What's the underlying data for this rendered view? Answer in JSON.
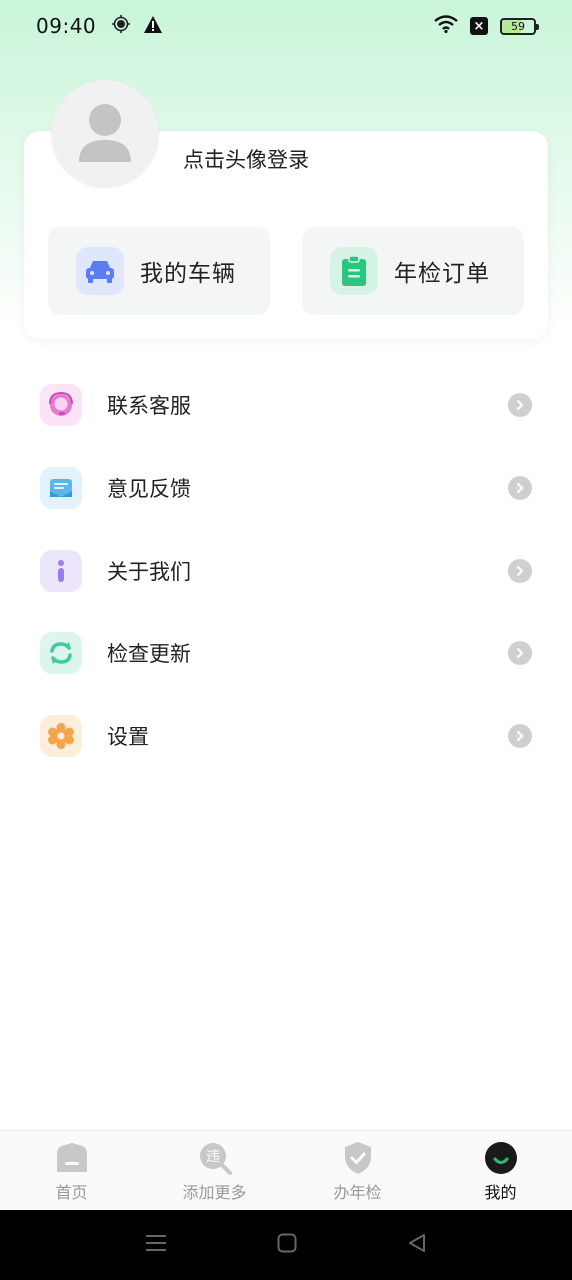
{
  "status_bar": {
    "time": "09:40",
    "battery": "59"
  },
  "profile": {
    "login_prompt": "点击头像登录",
    "quick_actions": [
      {
        "label": "我的车辆",
        "icon": "car-icon",
        "color": "#5b7cf2"
      },
      {
        "label": "年检订单",
        "icon": "clipboard-icon",
        "color": "#2cc57e"
      }
    ]
  },
  "menu": [
    {
      "label": "联系客服",
      "icon": "customer-service-icon",
      "color": "#e879d6"
    },
    {
      "label": "意见反馈",
      "icon": "feedback-icon",
      "color": "#5bb6ea"
    },
    {
      "label": "关于我们",
      "icon": "info-icon",
      "color": "#9b7cf0"
    },
    {
      "label": "检查更新",
      "icon": "refresh-icon",
      "color": "#3fcaa0"
    },
    {
      "label": "设置",
      "icon": "settings-gear-icon",
      "color": "#f5a54a"
    }
  ],
  "bottom_nav": [
    {
      "label": "首页",
      "icon": "home-icon",
      "active": false
    },
    {
      "label": "添加更多",
      "icon": "violation-search-icon",
      "active": false
    },
    {
      "label": "办年检",
      "icon": "shield-check-icon",
      "active": false
    },
    {
      "label": "我的",
      "icon": "profile-smile-icon",
      "active": true
    }
  ],
  "colors": {
    "accent": "#1ec46a",
    "background_gradient": "#c9f5d9"
  }
}
